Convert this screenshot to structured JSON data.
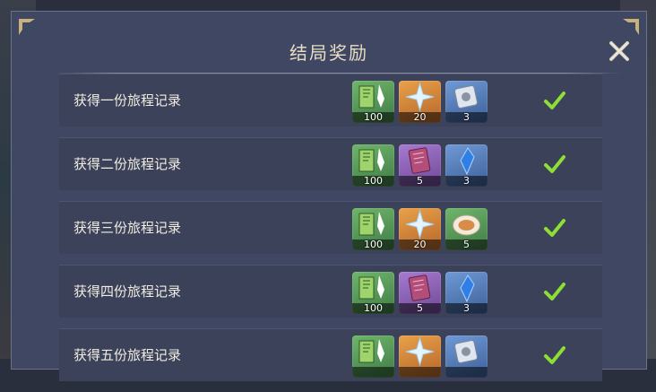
{
  "header": {
    "title": "结局奖励"
  },
  "colors": {
    "check": "#8ddf36",
    "tier_green": "#59a15a",
    "tier_orange": "#d88a3a",
    "tier_purple": "#9a68c3",
    "tier_blue": "#5d86c2"
  },
  "rows": [
    {
      "label": "获得一份旅程记录",
      "claimed": true,
      "rewards": [
        {
          "icon": "adventure-exp-icon",
          "tier": "green",
          "count": "100"
        },
        {
          "icon": "primogem-icon",
          "tier": "orange",
          "count": "20"
        },
        {
          "icon": "talent-book-icon",
          "tier": "blue",
          "count": "3"
        }
      ]
    },
    {
      "label": "获得二份旅程记录",
      "claimed": true,
      "rewards": [
        {
          "icon": "adventure-exp-icon",
          "tier": "green",
          "count": "100"
        },
        {
          "icon": "heros-wit-icon",
          "tier": "purple",
          "count": "5"
        },
        {
          "icon": "crystal-chunk-icon",
          "tier": "blue",
          "count": "3"
        }
      ]
    },
    {
      "label": "获得三份旅程记录",
      "claimed": true,
      "rewards": [
        {
          "icon": "adventure-exp-icon",
          "tier": "green",
          "count": "100"
        },
        {
          "icon": "primogem-icon",
          "tier": "orange",
          "count": "20"
        },
        {
          "icon": "food-dish-icon",
          "tier": "green",
          "count": "5"
        }
      ]
    },
    {
      "label": "获得四份旅程记录",
      "claimed": true,
      "rewards": [
        {
          "icon": "adventure-exp-icon",
          "tier": "green",
          "count": "100"
        },
        {
          "icon": "heros-wit-icon",
          "tier": "purple",
          "count": "5"
        },
        {
          "icon": "crystal-chunk-icon",
          "tier": "blue",
          "count": "3"
        }
      ]
    },
    {
      "label": "获得五份旅程记录",
      "claimed": true,
      "rewards": [
        {
          "icon": "adventure-exp-icon",
          "tier": "green",
          "count": ""
        },
        {
          "icon": "primogem-icon",
          "tier": "orange",
          "count": ""
        },
        {
          "icon": "talent-book-icon",
          "tier": "blue",
          "count": ""
        }
      ]
    }
  ]
}
